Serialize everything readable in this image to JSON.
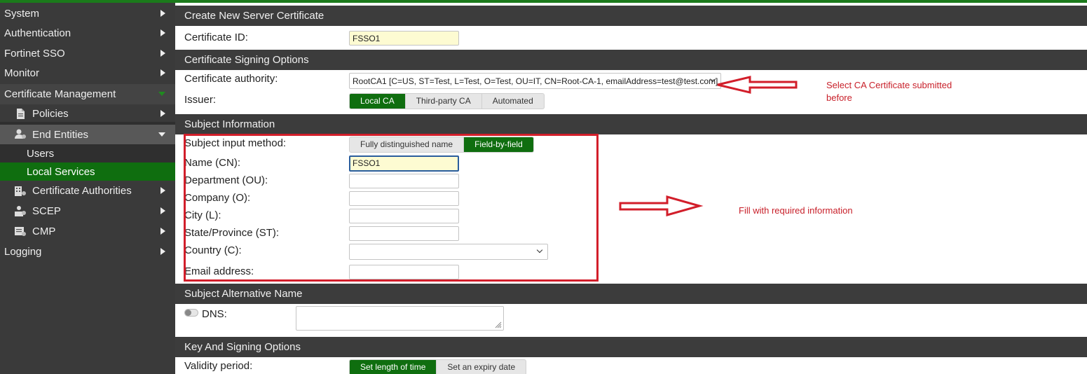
{
  "sidebar": {
    "items": [
      {
        "label": "System"
      },
      {
        "label": "Authentication"
      },
      {
        "label": "Fortinet SSO"
      },
      {
        "label": "Monitor"
      },
      {
        "label": "Certificate Management"
      },
      {
        "label": "Policies"
      },
      {
        "label": "End Entities"
      },
      {
        "label": "Users"
      },
      {
        "label": "Local Services"
      },
      {
        "label": "Certificate Authorities"
      },
      {
        "label": "SCEP"
      },
      {
        "label": "CMP"
      },
      {
        "label": "Logging"
      }
    ]
  },
  "form": {
    "title": "Create New Server Certificate",
    "certificate_id": {
      "label": "Certificate ID:",
      "value": "FSSO1"
    },
    "signing_options": {
      "heading": "Certificate Signing Options",
      "ca_label": "Certificate authority:",
      "ca_value": "RootCA1 [C=US, ST=Test, L=Test, O=Test, OU=IT, CN=Root-CA-1, emailAddress=test@test.com]",
      "issuer_label": "Issuer:",
      "issuer_options": [
        "Local CA",
        "Third-party CA",
        "Automated"
      ],
      "issuer_selected": "Local CA"
    },
    "subject": {
      "heading": "Subject Information",
      "input_method_label": "Subject input method:",
      "input_method_options": [
        "Fully distinguished name",
        "Field-by-field"
      ],
      "input_method_selected": "Field-by-field",
      "name_label": "Name (CN):",
      "name_value": "FSSO1",
      "department_label": "Department (OU):",
      "company_label": "Company (O):",
      "city_label": "City (L):",
      "state_label": "State/Province (ST):",
      "country_label": "Country (C):",
      "email_label": "Email address:"
    },
    "san": {
      "heading": "Subject Alternative Name",
      "dns_label": "DNS:"
    },
    "key_signing": {
      "heading": "Key And Signing Options",
      "validity_label": "Validity period:",
      "validity_options": [
        "Set length of time",
        "Set an expiry date"
      ],
      "validity_selected": "Set length of time"
    }
  },
  "annotations": {
    "ca_note_line1": "Select CA Certificate submitted",
    "ca_note_line2": "before",
    "fill_note": "Fill with required information"
  },
  "colors": {
    "accent_green": "#0f6e0f",
    "sidebar_bg": "#3a3a3a",
    "header_bg": "#3c3c3c",
    "annotation_red": "#d21e2a"
  }
}
